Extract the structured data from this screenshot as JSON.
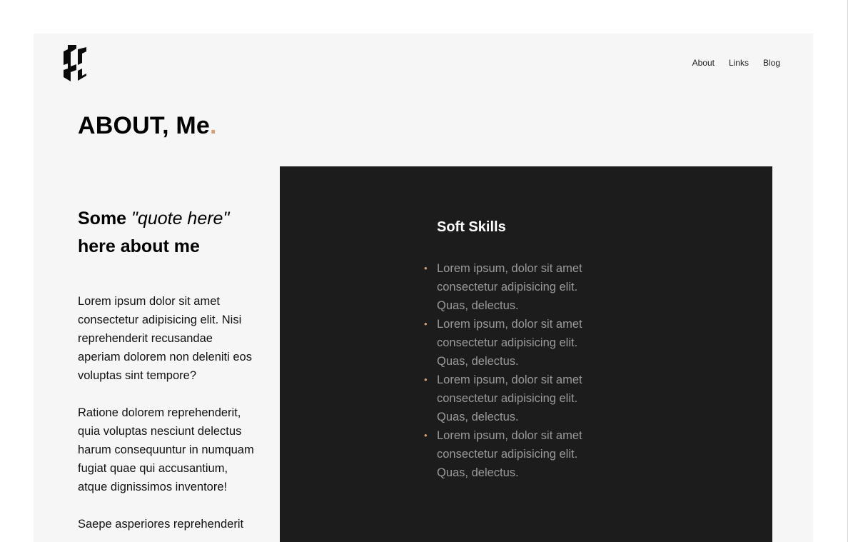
{
  "nav": {
    "items": [
      "About",
      "Links",
      "Blog"
    ]
  },
  "title": {
    "main": "ABOUT, Me",
    "dot": "."
  },
  "quote": {
    "some": "Some",
    "quote": "\"quote here\"",
    "rest": "here about me"
  },
  "bio": {
    "paragraphs": [
      "Lorem ipsum dolor sit amet consectetur adipisicing elit. Nisi reprehenderit recusandae aperiam dolorem non deleniti eos voluptas sint tempore?",
      "Ratione dolorem reprehenderit, quia voluptas nesciunt delectus harum consequuntur in numquam fugiat quae qui accusantium, atque dignissimos inventore!",
      "Saepe asperiores reprehenderit"
    ]
  },
  "skills": {
    "title": "Soft Skills",
    "items": [
      "Lorem ipsum, dolor sit amet consectetur adipisicing elit. Quas, delectus.",
      "Lorem ipsum, dolor sit amet consectetur adipisicing elit. Quas, delectus.",
      "Lorem ipsum, dolor sit amet consectetur adipisicing elit. Quas, delectus.",
      "Lorem ipsum, dolor sit amet consectetur adipisicing elit. Quas, delectus."
    ]
  },
  "colors": {
    "accent": "#d5a075",
    "panel": "#1c1c1d",
    "background": "#f6f6f6"
  }
}
